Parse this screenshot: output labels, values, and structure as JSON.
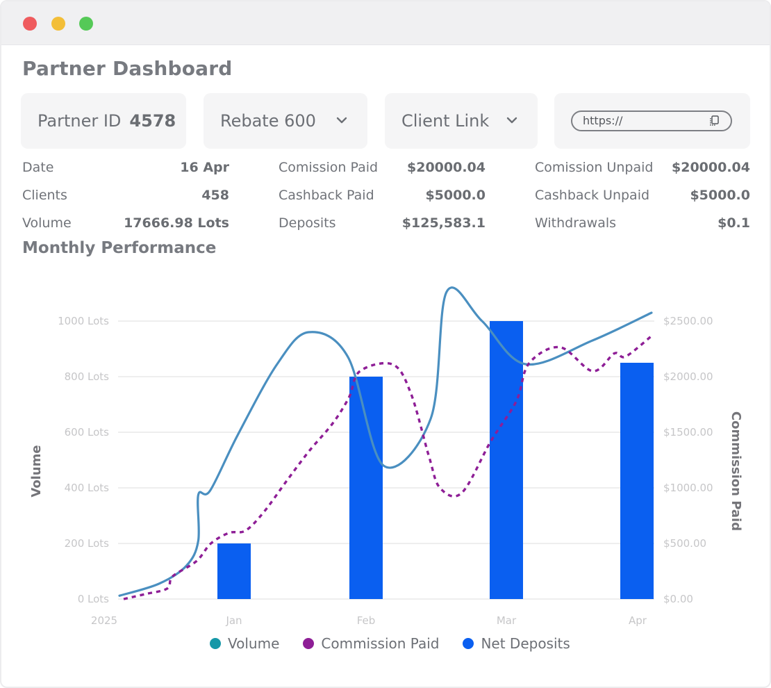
{
  "window": {
    "title": "Partner Dashboard"
  },
  "cards": {
    "partner_id_label": "Partner ID",
    "partner_id_value": "4578",
    "rebate_label": "Rebate 600",
    "client_link_label": "Client Link",
    "url_text": "https://"
  },
  "stats": [
    {
      "label": "Date",
      "value": "16 Apr"
    },
    {
      "label": "Clients",
      "value": "458"
    },
    {
      "label": "Volume",
      "value": "17666.98 Lots"
    },
    {
      "label": "Comission Paid",
      "value": "$20000.04"
    },
    {
      "label": "Cashback Paid",
      "value": "$5000.0"
    },
    {
      "label": "Deposits",
      "value": "$125,583.1"
    },
    {
      "label": "Comission Unpaid",
      "value": "$20000.04"
    },
    {
      "label": "Cashback Unpaid",
      "value": "$5000.0"
    },
    {
      "label": "Withdrawals",
      "value": "$0.1"
    }
  ],
  "section": {
    "title": "Monthly Performance"
  },
  "colors": {
    "volume": "#4a8fc0",
    "commission": "#8e1e96",
    "net_deposits": "#0a5ff0",
    "legend_volume": "#1598a8",
    "grid": "#eeeeee",
    "tick": "#c6c6c8"
  },
  "chart_data": {
    "type": "bar",
    "x": [
      "2025",
      "Jan",
      "Feb",
      "Mar",
      "Apr"
    ],
    "ylabel_left": "Volume",
    "ylabel_right": "Commission Paid",
    "left_ticks": [
      "0 Lots",
      "200 Lots",
      "400 Lots",
      "600 Lots",
      "800 Lots",
      "1000 Lots"
    ],
    "right_ticks": [
      "$0.00",
      "$500.00",
      "$1000.00",
      "$1500.00",
      "$2000.00",
      "$2500.00"
    ],
    "ylim_left": [
      0,
      1000
    ],
    "ylim_right": [
      0,
      2500
    ],
    "grid": true,
    "legend_position": "bottom",
    "series": [
      {
        "name": "Net Deposits",
        "type": "bar",
        "axis": "left",
        "x": [
          "Jan",
          "Feb",
          "Mar",
          "Apr"
        ],
        "values": [
          200,
          800,
          1000,
          850
        ]
      },
      {
        "name": "Volume",
        "type": "line",
        "axis": "left",
        "points": [
          [
            0,
            12
          ],
          [
            0.5,
            55
          ],
          [
            0.85,
            120
          ],
          [
            1,
            210
          ],
          [
            1,
            375
          ],
          [
            1.15,
            390
          ],
          [
            1.5,
            590
          ],
          [
            2.0,
            845
          ],
          [
            2.4,
            960
          ],
          [
            2.9,
            870
          ],
          [
            3.35,
            480
          ],
          [
            3.95,
            650
          ],
          [
            4.15,
            1105
          ],
          [
            4.6,
            1000
          ],
          [
            5.15,
            845
          ],
          [
            6.0,
            930
          ],
          [
            6.75,
            1030
          ]
        ]
      },
      {
        "name": "Commission Paid",
        "type": "line",
        "axis": "right",
        "points": [
          [
            0,
            0
          ],
          [
            0.6,
            45
          ],
          [
            1.2,
            95
          ],
          [
            1.35,
            205
          ],
          [
            2.0,
            340
          ],
          [
            2.4,
            500
          ],
          [
            2.9,
            595
          ],
          [
            3.35,
            615
          ],
          [
            3.85,
            780
          ],
          [
            4.5,
            1070
          ],
          [
            5.1,
            1330
          ],
          [
            5.75,
            1580
          ],
          [
            6.2,
            1815
          ],
          [
            6.5,
            2050
          ],
          [
            7.4,
            2110
          ],
          [
            7.9,
            1850
          ],
          [
            8.4,
            1280
          ],
          [
            8.7,
            1000
          ],
          [
            9.3,
            955
          ],
          [
            10.1,
            1420
          ],
          [
            10.8,
            1780
          ],
          [
            11.15,
            2120
          ],
          [
            12.0,
            2265
          ],
          [
            12.9,
            2050
          ],
          [
            13.5,
            2210
          ],
          [
            13.8,
            2180
          ],
          [
            14.5,
            2360
          ]
        ]
      }
    ]
  },
  "legend": [
    "Volume",
    "Commission Paid",
    "Net Deposits"
  ]
}
